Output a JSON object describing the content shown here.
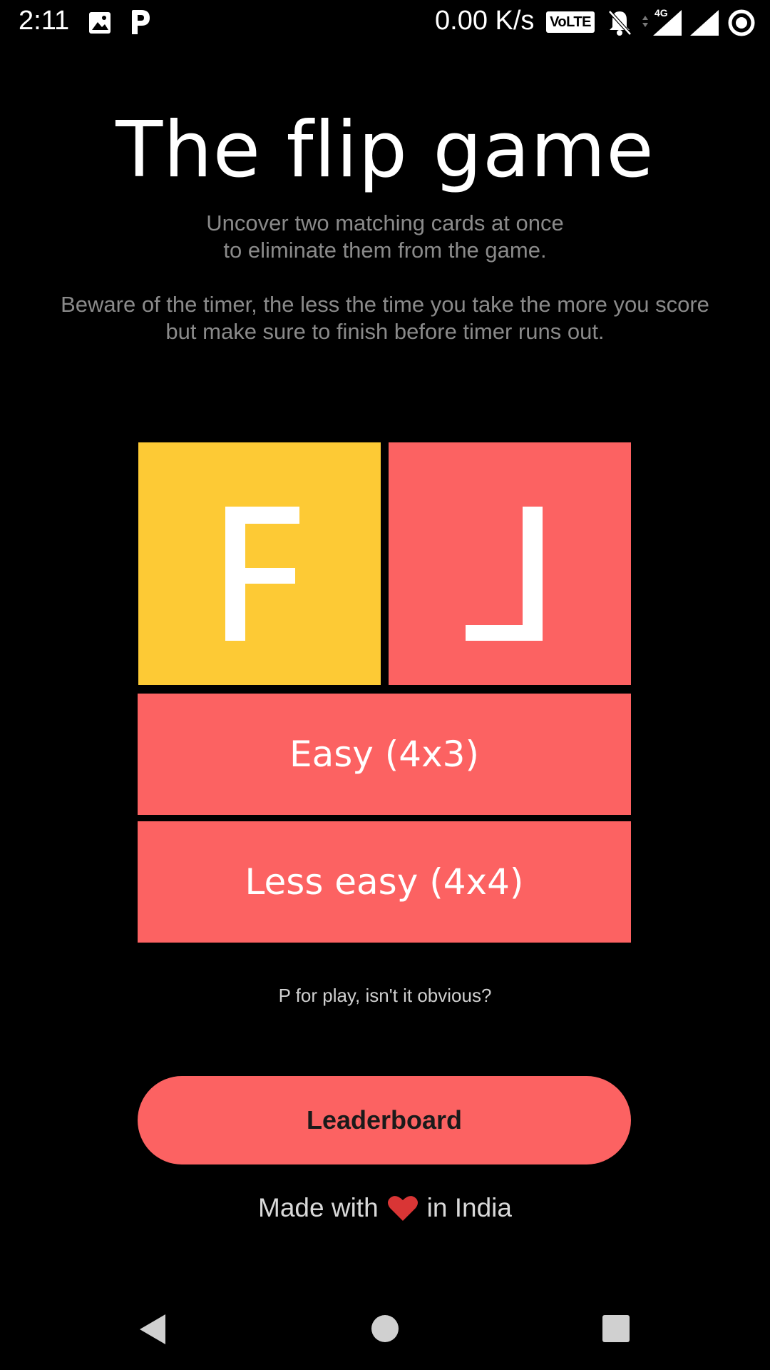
{
  "status_bar": {
    "time": "2:11",
    "net_speed": "0.00 K/s",
    "volte": "VoLTE",
    "network_type": "4G",
    "icons": [
      "image-icon",
      "p-app-icon",
      "volte-icon",
      "muted-bell-icon",
      "signal-icon",
      "signal-icon",
      "circle-status-icon"
    ]
  },
  "header": {
    "title": "The flip game",
    "desc1_line1": "Uncover two matching cards at once",
    "desc1_line2": "to eliminate them from the game.",
    "desc2_line1": "Beware of the timer, the less the time you take the more you score",
    "desc2_line2": "but make sure to finish before timer runs out."
  },
  "logo": {
    "tile_left_color": "#FDCA35",
    "tile_right_color": "#FC6262"
  },
  "buttons": {
    "easy": "Easy (4x3)",
    "less_easy": "Less easy (4x4)",
    "hint": "P for play, isn't it obvious?",
    "leaderboard": "Leaderboard"
  },
  "footer": {
    "made_prefix": "Made with",
    "made_suffix": "in India"
  },
  "colors": {
    "accent": "#FC6262",
    "yellow": "#FDCA35",
    "background": "#000000"
  },
  "nav_bar": {
    "icons": [
      "back-icon",
      "home-icon",
      "recents-icon"
    ]
  }
}
